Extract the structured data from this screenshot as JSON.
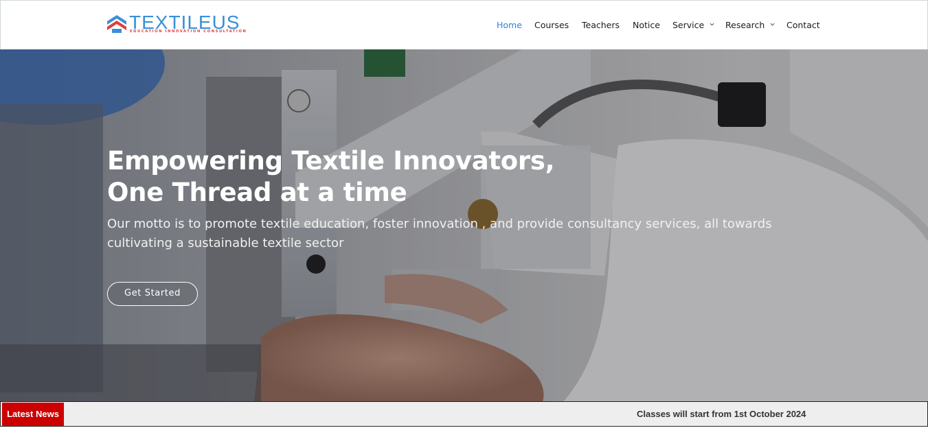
{
  "brand": {
    "name": "TEXTILEUS",
    "tagline": "EDUCATION INNOVATION CONSULTATION",
    "colors": {
      "blue": "#3b8fd6",
      "red": "#e0403a"
    }
  },
  "nav": {
    "items": [
      {
        "label": "Home",
        "active": true
      },
      {
        "label": "Courses"
      },
      {
        "label": "Teachers"
      },
      {
        "label": "Notice"
      },
      {
        "label": "Service",
        "dropdown": true
      },
      {
        "label": "Research",
        "dropdown": true
      },
      {
        "label": "Contact"
      }
    ],
    "active_color": "#2f7fe0"
  },
  "hero": {
    "title_line1": "Empowering Textile Innovators,",
    "title_line2": "One Thread at a time",
    "subtitle": "Our motto is to promote textile education, foster innovation , and provide consultancy services, all towards cultivating a sustainable textile sector",
    "cta_label": "Get Started"
  },
  "news": {
    "label": "Latest News",
    "text": "Classes will start from 1st October 2024",
    "label_color": "#cc0000"
  }
}
